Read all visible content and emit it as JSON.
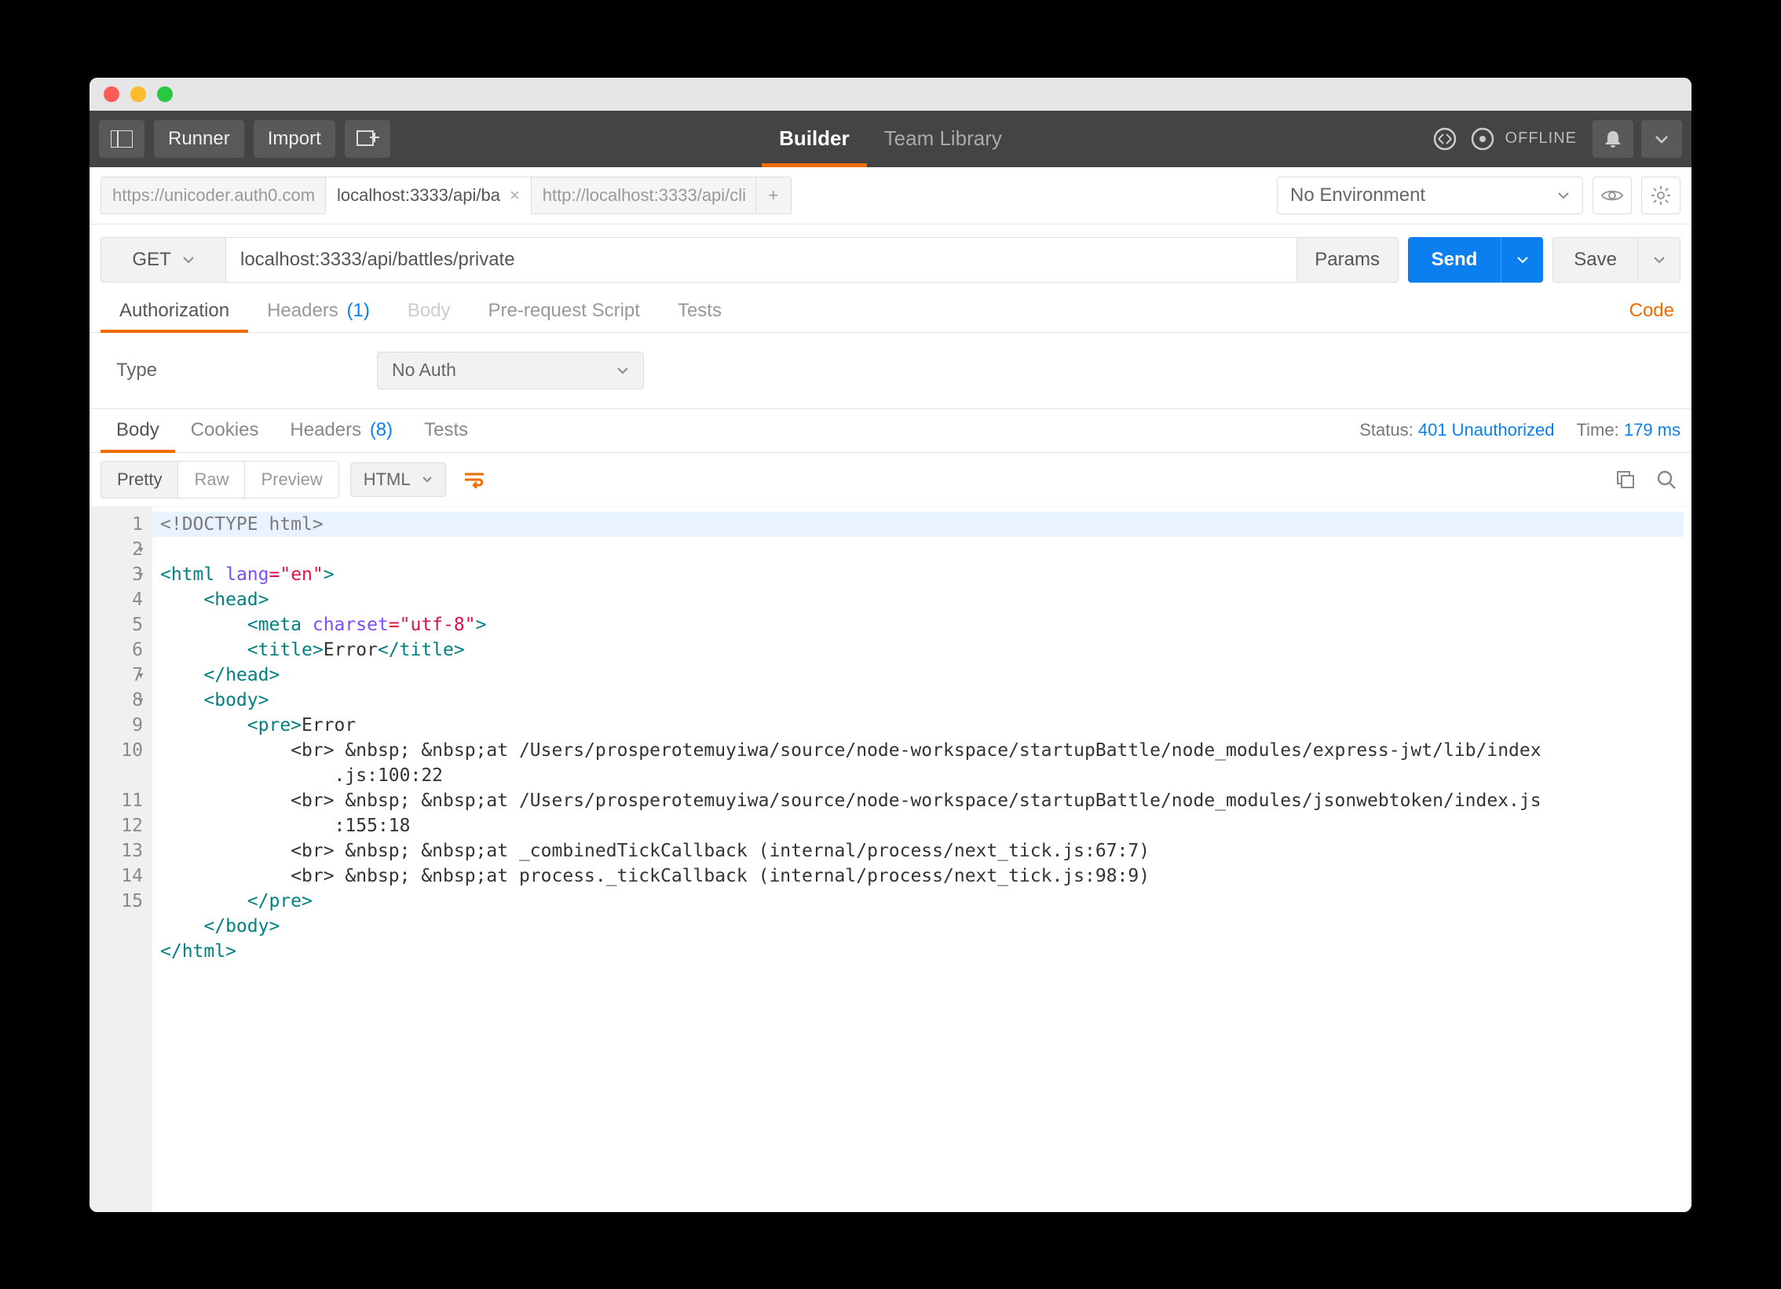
{
  "toolbar": {
    "runner": "Runner",
    "import": "Import",
    "builder": "Builder",
    "team_library": "Team Library",
    "offline": "OFFLINE"
  },
  "tabs": {
    "t0": "https://unicoder.auth0.com",
    "t1": "localhost:3333/api/ba",
    "t2": "http://localhost:3333/api/cli",
    "add": "+"
  },
  "env": {
    "selected": "No Environment"
  },
  "request": {
    "method": "GET",
    "url": "localhost:3333/api/battles/private",
    "params": "Params",
    "send": "Send",
    "save": "Save"
  },
  "req_tabs": {
    "auth": "Authorization",
    "headers": "Headers",
    "headers_count": "(1)",
    "body": "Body",
    "prs": "Pre-request Script",
    "tests": "Tests",
    "code": "Code"
  },
  "auth": {
    "type_label": "Type",
    "type_value": "No Auth"
  },
  "res_tabs": {
    "body": "Body",
    "cookies": "Cookies",
    "headers": "Headers",
    "headers_count": "(8)",
    "tests": "Tests"
  },
  "res_meta": {
    "status_label": "Status:",
    "status_value": "401 Unauthorized",
    "time_label": "Time:",
    "time_value": "179 ms"
  },
  "body_tb": {
    "pretty": "Pretty",
    "raw": "Raw",
    "preview": "Preview",
    "fmt": "HTML"
  },
  "code": {
    "l1": "<!DOCTYPE html>",
    "l2a": "<html",
    "l2b": " lang",
    "l2c": "=\"en\"",
    "l2d": ">",
    "l3": "    <head>",
    "l4a": "        <meta",
    "l4b": " charset",
    "l4c": "=\"utf-8\"",
    "l4d": ">",
    "l5a": "        <title>",
    "l5b": "Error",
    "l5c": "</title>",
    "l6": "    </head>",
    "l7": "    <body>",
    "l8a": "        <pre>",
    "l8b": "Error",
    "l9": "            <br> &nbsp; &nbsp;at /Users/prosperotemuyiwa/source/node-workspace/startupBattle/node_modules/express-jwt/lib/index\n                .js:100:22",
    "l10": "            <br> &nbsp; &nbsp;at /Users/prosperotemuyiwa/source/node-workspace/startupBattle/node_modules/jsonwebtoken/index.js\n                :155:18",
    "l11": "            <br> &nbsp; &nbsp;at _combinedTickCallback (internal/process/next_tick.js:67:7)",
    "l12": "            <br> &nbsp; &nbsp;at process._tickCallback (internal/process/next_tick.js:98:9)",
    "l13": "        </pre>",
    "l14": "    </body>",
    "l15": "</html>"
  },
  "gutter": [
    "1",
    "2",
    "3",
    "4",
    "5",
    "6",
    "7",
    "8",
    "9",
    "10",
    "11",
    "12",
    "13",
    "14",
    "15"
  ]
}
